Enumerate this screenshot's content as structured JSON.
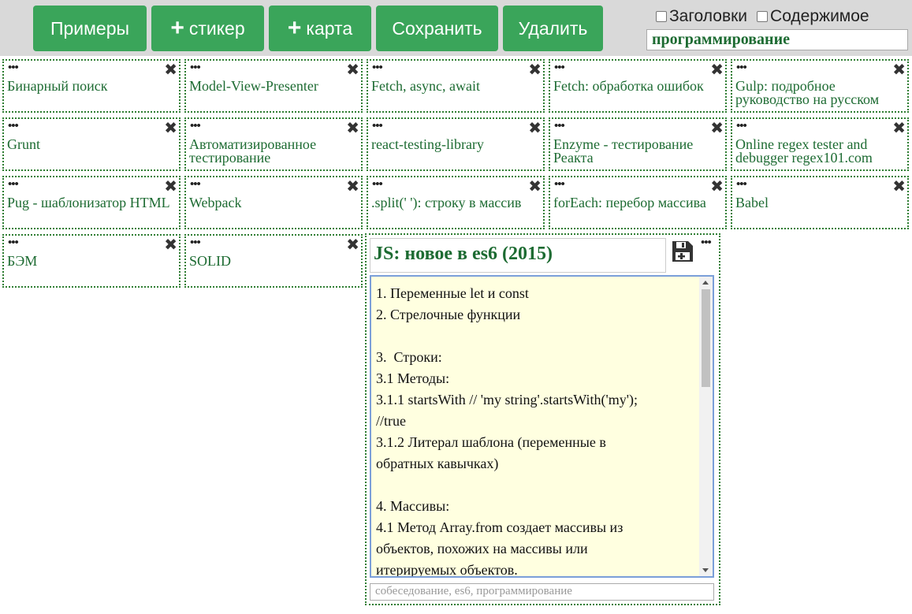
{
  "toolbar": {
    "examples_label": "Примеры",
    "add_sticker_label": "стикер",
    "add_card_label": "карта",
    "save_label": "Сохранить",
    "delete_label": "Удалить",
    "headings_label": "Заголовки",
    "content_label": "Содержимое",
    "search_value": "программирование"
  },
  "icons": {
    "plus": "+",
    "close": "✖",
    "dots": "•••"
  },
  "colors": {
    "button_green": "#3aa55a",
    "title_green": "#1d6b32",
    "note_background": "#ffffe0"
  },
  "cards": [
    "Бинарный поиск",
    "Model-View-Presenter",
    "Fetch, async, await",
    "Fetch: обработка ошибок",
    "Gulp: подробное руководство на русском",
    "Grunt",
    "Автоматизированное тестирование",
    "react-testing-library",
    "Enzyme - тестирование Реакта",
    "Online regex tester and debugger regex101.com",
    "Pug - шаблонизатор HTML",
    "Webpack",
    ".split(' '): строку в массив",
    "forEach: перебор массива",
    "Babel",
    "БЭМ",
    "SOLID"
  ],
  "expanded_card": {
    "title": "JS: новое в es6 (2015)",
    "lines": [
      "1. Переменные let и const",
      "2. Стрелочные функции",
      "",
      "3.  Строки:",
      "3.1 Методы:",
      "3.1.1 startsWith // 'my string'.startsWith('my');",
      "//true",
      "3.1.2 Литерал шаблона (переменные в",
      "обратных кавычках)",
      "",
      "4. Массивы:",
      "4.1 Метод Array.from создает массивы из",
      "объектов, похожих на массивы или",
      "итерируемых объектов."
    ],
    "tags": "собеседование, es6, программирование"
  }
}
